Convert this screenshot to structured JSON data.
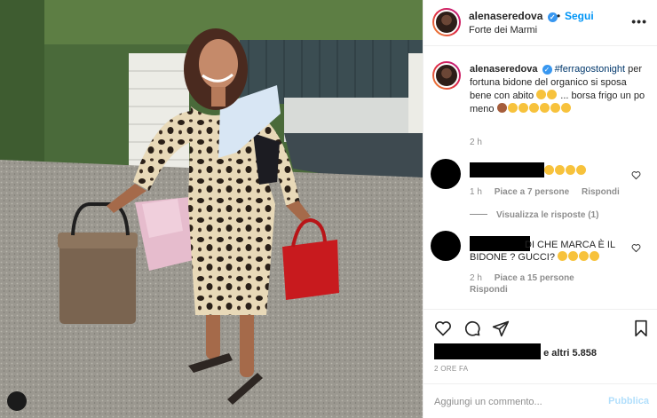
{
  "post": {
    "username": "alenaseredova",
    "verified_mark": "✓",
    "separator": "•",
    "follow_label": "Segui",
    "location": "Forte dei Marmi",
    "more_label": "•••"
  },
  "caption": {
    "username": "alenaseredova",
    "hashtag": "#ferragostonight",
    "text_1": "per fortuna bidone del organico si sposa bene con abito",
    "text_2": "... borsa frigo un po meno",
    "time": "2 h"
  },
  "comments": [
    {
      "text": "",
      "emoji_count": 4,
      "time": "1 h",
      "likes": "Piace a 7 persone",
      "reply": "Rispondi"
    },
    {
      "text": "DI CHE MARCA È IL BIDONE ? GUCCI?",
      "time": "2 h",
      "likes": "Piace a 15 persone",
      "reply": "Rispondi"
    }
  ],
  "view_replies": "Visualizza le risposte (1)",
  "likes_suffix": "e altri 5.858",
  "post_age": "2 ORE FA",
  "add_comment": {
    "placeholder": "Aggiungi un commento...",
    "publish_label": "Pubblica"
  },
  "colors": {
    "accent": "#0095f6",
    "muted": "#8e8e8e",
    "publish_disabled": "#b2dffc",
    "hashtag": "#00376b"
  },
  "icons": [
    "heart-icon",
    "comment-icon",
    "share-icon",
    "bookmark-icon",
    "more-icon",
    "verified-icon",
    "user-tag-icon"
  ]
}
